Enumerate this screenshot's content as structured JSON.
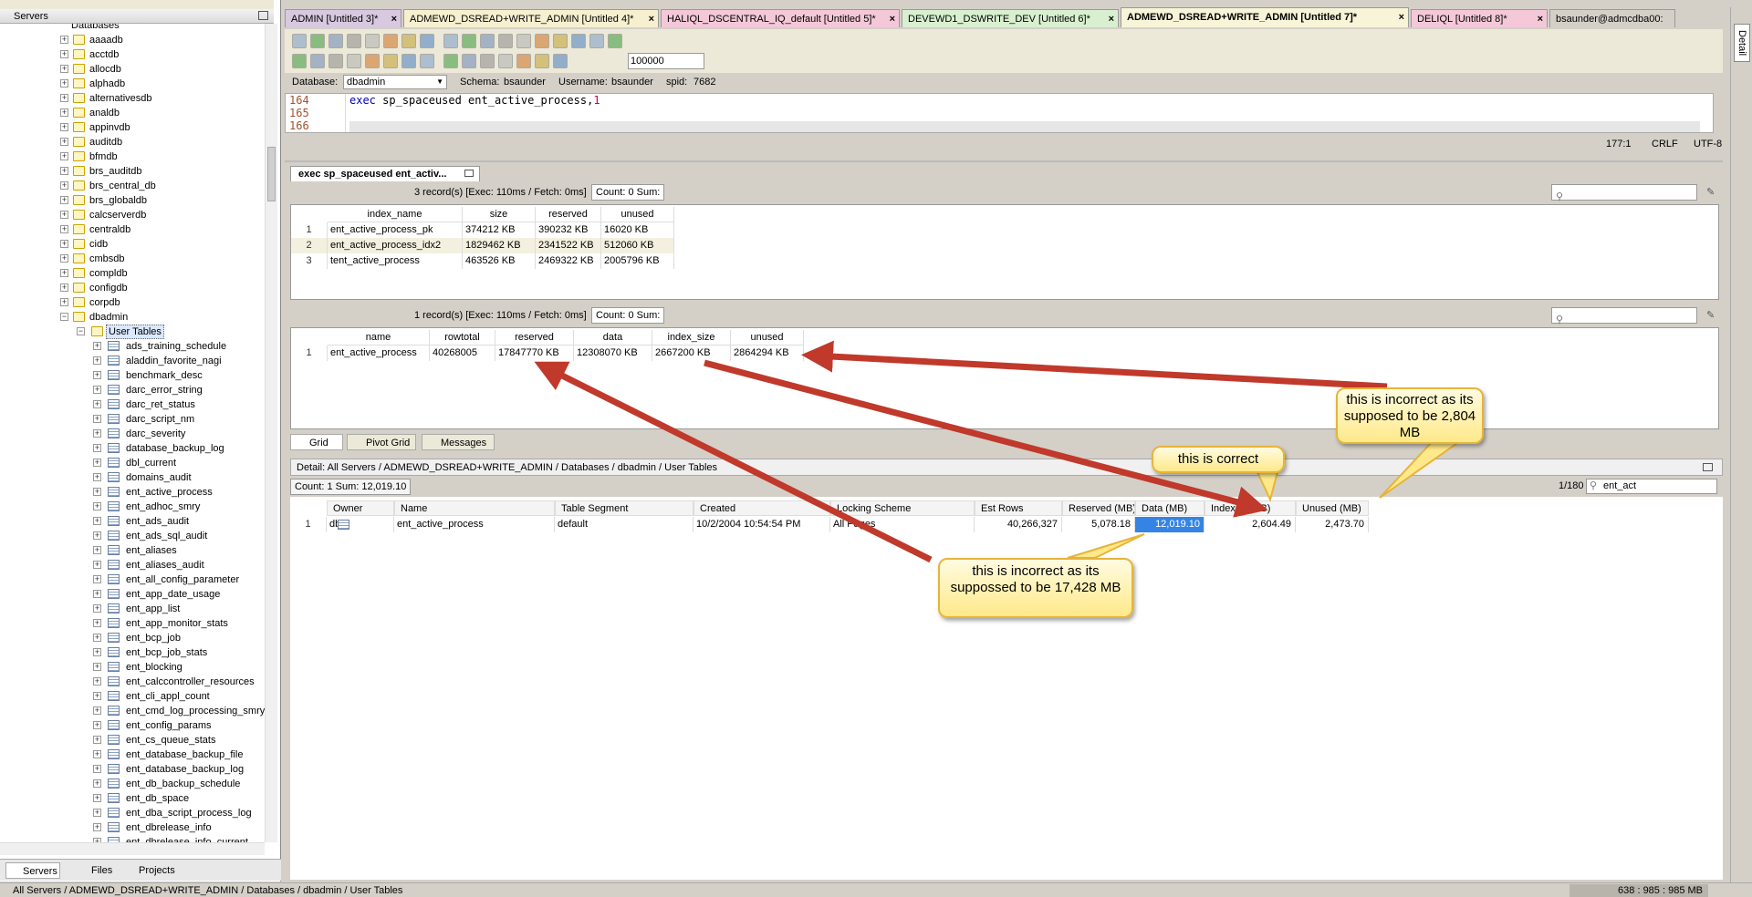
{
  "left_panel": {
    "title": "Servers",
    "top_item": "Databases",
    "databases": [
      "aaaadb",
      "acctdb",
      "allocdb",
      "alphadb",
      "alternativesdb",
      "analdb",
      "appinvdb",
      "auditdb",
      "bfmdb",
      "brs_auditdb",
      "brs_central_db",
      "brs_globaldb",
      "calcserverdb",
      "centraldb",
      "cidb",
      "cmbsdb",
      "compldb",
      "configdb",
      "corpdb",
      "dbadmin"
    ],
    "folder": "User Tables",
    "tables": [
      "ads_training_schedule",
      "aladdin_favorite_nagi",
      "benchmark_desc",
      "darc_error_string",
      "darc_ret_status",
      "darc_script_nm",
      "darc_severity",
      "database_backup_log",
      "dbl_current",
      "domains_audit",
      "ent_active_process",
      "ent_adhoc_smry",
      "ent_ads_audit",
      "ent_ads_sql_audit",
      "ent_aliases",
      "ent_aliases_audit",
      "ent_all_config_parameter",
      "ent_app_date_usage",
      "ent_app_list",
      "ent_app_monitor_stats",
      "ent_bcp_job",
      "ent_bcp_job_stats",
      "ent_blocking",
      "ent_calccontroller_resources",
      "ent_cli_appl_count",
      "ent_cmd_log_processing_smry",
      "ent_config_params",
      "ent_cs_queue_stats",
      "ent_database_backup_file",
      "ent_database_backup_log",
      "ent_db_backup_schedule",
      "ent_db_space",
      "ent_dba_script_process_log",
      "ent_dbrelease_info",
      "ent_dbrelease_info_current"
    ],
    "tabs": [
      "Servers",
      "Files",
      "Projects"
    ]
  },
  "tabs": [
    {
      "label": "ADMIN [Untitled 3]*",
      "color": "#d8c8e0"
    },
    {
      "label": "ADMEWD_DSREAD+WRITE_ADMIN [Untitled 4]*",
      "color": "#f6f0d0"
    },
    {
      "label": "HALIQL_DSCENTRAL_IQ_default [Untitled 5]*",
      "color": "#f4c8d8"
    },
    {
      "label": "DEVEWD1_DSWRITE_DEV [Untitled 6]*",
      "color": "#d8f0d0"
    },
    {
      "label": "ADMEWD_DSREAD+WRITE_ADMIN [Untitled 7]*",
      "color": "#f8f4d8"
    },
    {
      "label": "DELIQL [Untitled 8]*",
      "color": "#f4c8d8"
    },
    {
      "label": "bsaunder@admcdba00:",
      "color": "#d4d0c8"
    }
  ],
  "toolbar": {
    "rowlimit": "100000"
  },
  "dbbar": {
    "database_label": "Database:",
    "database": "dbadmin",
    "schema_label": "Schema:",
    "schema": "bsaunder",
    "username_label": "Username:",
    "username": "bsaunder",
    "spid_label": "spid:",
    "spid": "7682"
  },
  "editor": {
    "lines": [
      "164",
      "165",
      "166"
    ],
    "code_kw": "exec",
    "code_rest": "sp_spaceused ent_active_process,",
    "code_num": "1"
  },
  "status": {
    "pos": "177:1",
    "eol": "CRLF",
    "enc": "UTF-8"
  },
  "result_tab": "exec sp_spaceused ent_activ...",
  "grid1": {
    "info": "3 record(s) [Exec: 110ms / Fetch: 0ms]",
    "count": "Count: 0  Sum:",
    "headers": [
      "index_name",
      "size",
      "reserved",
      "unused"
    ],
    "rows": [
      [
        "1",
        "ent_active_process_pk",
        "374212 KB",
        "390232 KB",
        "16020 KB"
      ],
      [
        "2",
        "ent_active_process_idx2",
        "1829462 KB",
        "2341522 KB",
        "512060 KB"
      ],
      [
        "3",
        "tent_active_process",
        "463526 KB",
        "2469322 KB",
        "2005796 KB"
      ]
    ]
  },
  "grid2": {
    "info": "1 record(s) [Exec: 110ms / Fetch: 0ms]",
    "count": "Count: 0  Sum:",
    "headers": [
      "name",
      "rowtotal",
      "reserved",
      "data",
      "index_size",
      "unused"
    ],
    "rows": [
      [
        "1",
        "ent_active_process",
        "40268005",
        "17847770 KB",
        "12308070 KB",
        "2667200 KB",
        "2864294 KB"
      ]
    ]
  },
  "bottom_tabs": [
    "Grid",
    "Pivot Grid",
    "Messages"
  ],
  "detail_path": "Detail: All Servers / ADMEWD_DSREAD+WRITE_ADMIN / Databases / dbadmin / User Tables",
  "detail": {
    "count": "Count: 1  Sum: 12,019.10",
    "page": "1/180",
    "filter": "ent_act",
    "headers": [
      "Owner",
      "Name",
      "Table Segment",
      "Created",
      "Locking Scheme",
      "Est Rows",
      "Reserved (MB)",
      "Data (MB)",
      "Indexes (MB)",
      "Unused (MB)"
    ],
    "row": [
      "1",
      "dbo",
      "ent_active_process",
      "default",
      "10/2/2004 10:54:54 PM",
      "All Pages",
      "40,266,327",
      "5,078.18",
      "12,019.10",
      "2,604.49",
      "2,473.70"
    ]
  },
  "callouts": {
    "correct": "this is correct",
    "unused": "this is incorrect as its supposed to be 2,804 MB",
    "reserved": "this is incorrect as its suppossed to be 17,428 MB"
  },
  "bottom_status": {
    "path": "All Servers / ADMEWD_DSREAD+WRITE_ADMIN / Databases / dbadmin / User Tables",
    "mem": "638 : 985 : 985 MB"
  },
  "side_tab": "Detail"
}
